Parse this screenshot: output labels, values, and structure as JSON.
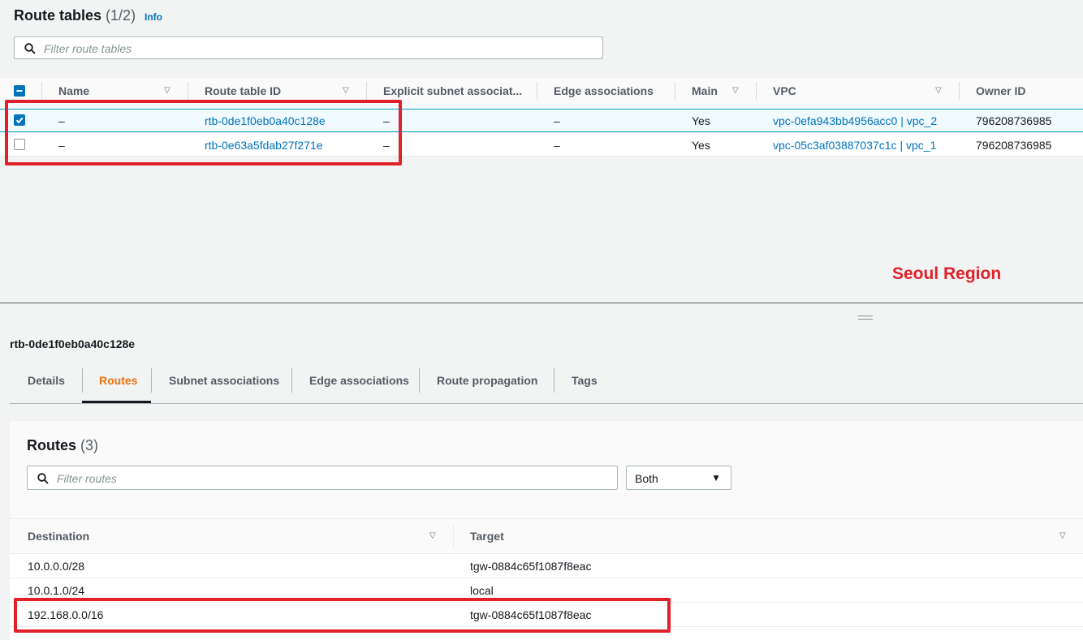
{
  "route_tables": {
    "title": "Route tables",
    "count": "(1/2)",
    "info_label": "Info",
    "search_placeholder": "Filter route tables",
    "columns": [
      "Name",
      "Route table ID",
      "Explicit subnet associat...",
      "Edge associations",
      "Main",
      "VPC",
      "Owner ID"
    ],
    "rows": [
      {
        "selected": true,
        "name": "–",
        "id": "rtb-0de1f0eb0a40c128e",
        "explicit": "–",
        "edge": "–",
        "main": "Yes",
        "vpc": "vpc-0efa943bb4956acc0 | vpc_2",
        "owner": "796208736985"
      },
      {
        "selected": false,
        "name": "–",
        "id": "rtb-0e63a5fdab27f271e",
        "explicit": "–",
        "edge": "–",
        "main": "Yes",
        "vpc": "vpc-05c3af03887037c1c | vpc_1",
        "owner": "796208736985"
      }
    ]
  },
  "annotation": {
    "region_label": "Seoul Region",
    "color": "#e0212b"
  },
  "detail": {
    "title": "rtb-0de1f0eb0a40c128e",
    "tabs": [
      "Details",
      "Routes",
      "Subnet associations",
      "Edge associations",
      "Route propagation",
      "Tags"
    ],
    "active_tab": "Routes"
  },
  "routes": {
    "title": "Routes",
    "count": "(3)",
    "search_placeholder": "Filter routes",
    "filter_select": "Both",
    "columns": [
      "Destination",
      "Target"
    ],
    "rows": [
      {
        "destination": "10.0.0.0/28",
        "target": "tgw-0884c65f1087f8eac"
      },
      {
        "destination": "10.0.1.0/24",
        "target": "local"
      },
      {
        "destination": "192.168.0.0/16",
        "target": "tgw-0884c65f1087f8eac"
      }
    ]
  },
  "colors": {
    "link": "#0073bb",
    "active_tab": "#ec7211",
    "highlight": "#e0212b",
    "selected_row": "#f1faff"
  }
}
